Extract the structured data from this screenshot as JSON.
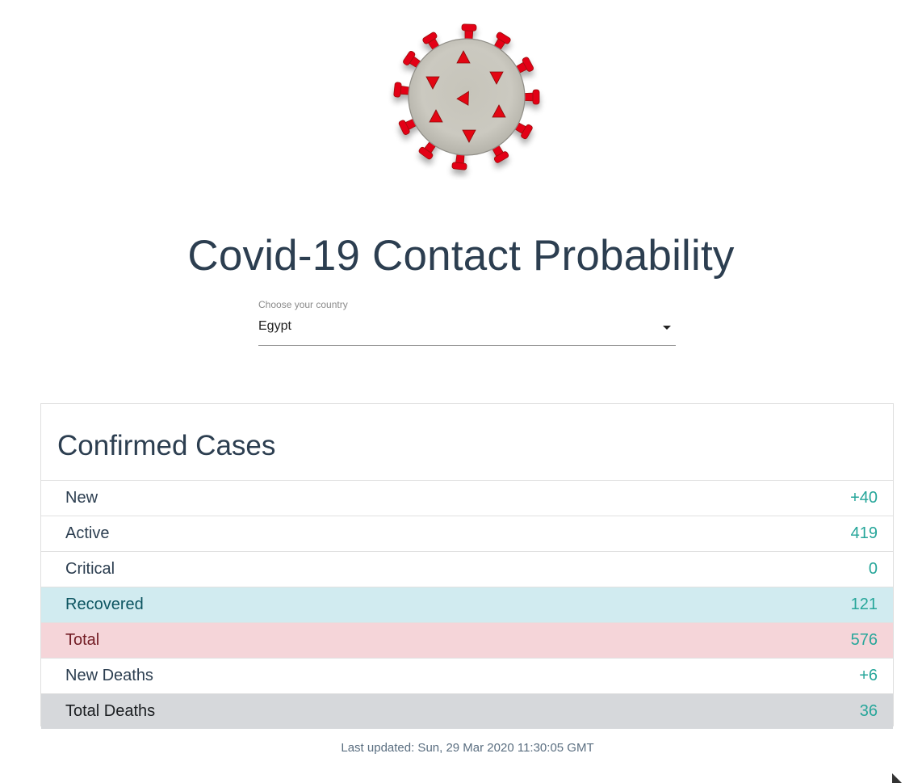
{
  "app": {
    "title": "Covid-19 Contact Probability",
    "logo_icon": "virus-icon"
  },
  "country_select": {
    "label": "Choose your country",
    "value": "Egypt"
  },
  "confirmed_cases": {
    "title": "Confirmed Cases",
    "rows": [
      {
        "label": "New",
        "value": "+40"
      },
      {
        "label": "Active",
        "value": "419"
      },
      {
        "label": "Critical",
        "value": "0"
      },
      {
        "label": "Recovered",
        "value": "121"
      },
      {
        "label": "Total",
        "value": "576"
      },
      {
        "label": "New Deaths",
        "value": "+6"
      },
      {
        "label": "Total Deaths",
        "value": "36"
      }
    ]
  },
  "footer": {
    "last_updated": "Last updated: Sun, 29 Mar 2020 11:30:05 GMT"
  },
  "colors": {
    "title": "#2c3e50",
    "value_accent": "#26a69a",
    "recovered_bg": "#d1ebf0",
    "total_bg": "#f5d5d9",
    "total_deaths_bg": "#d6d8db",
    "virus_spike": "#e30613",
    "virus_body": "#c9c7be"
  }
}
